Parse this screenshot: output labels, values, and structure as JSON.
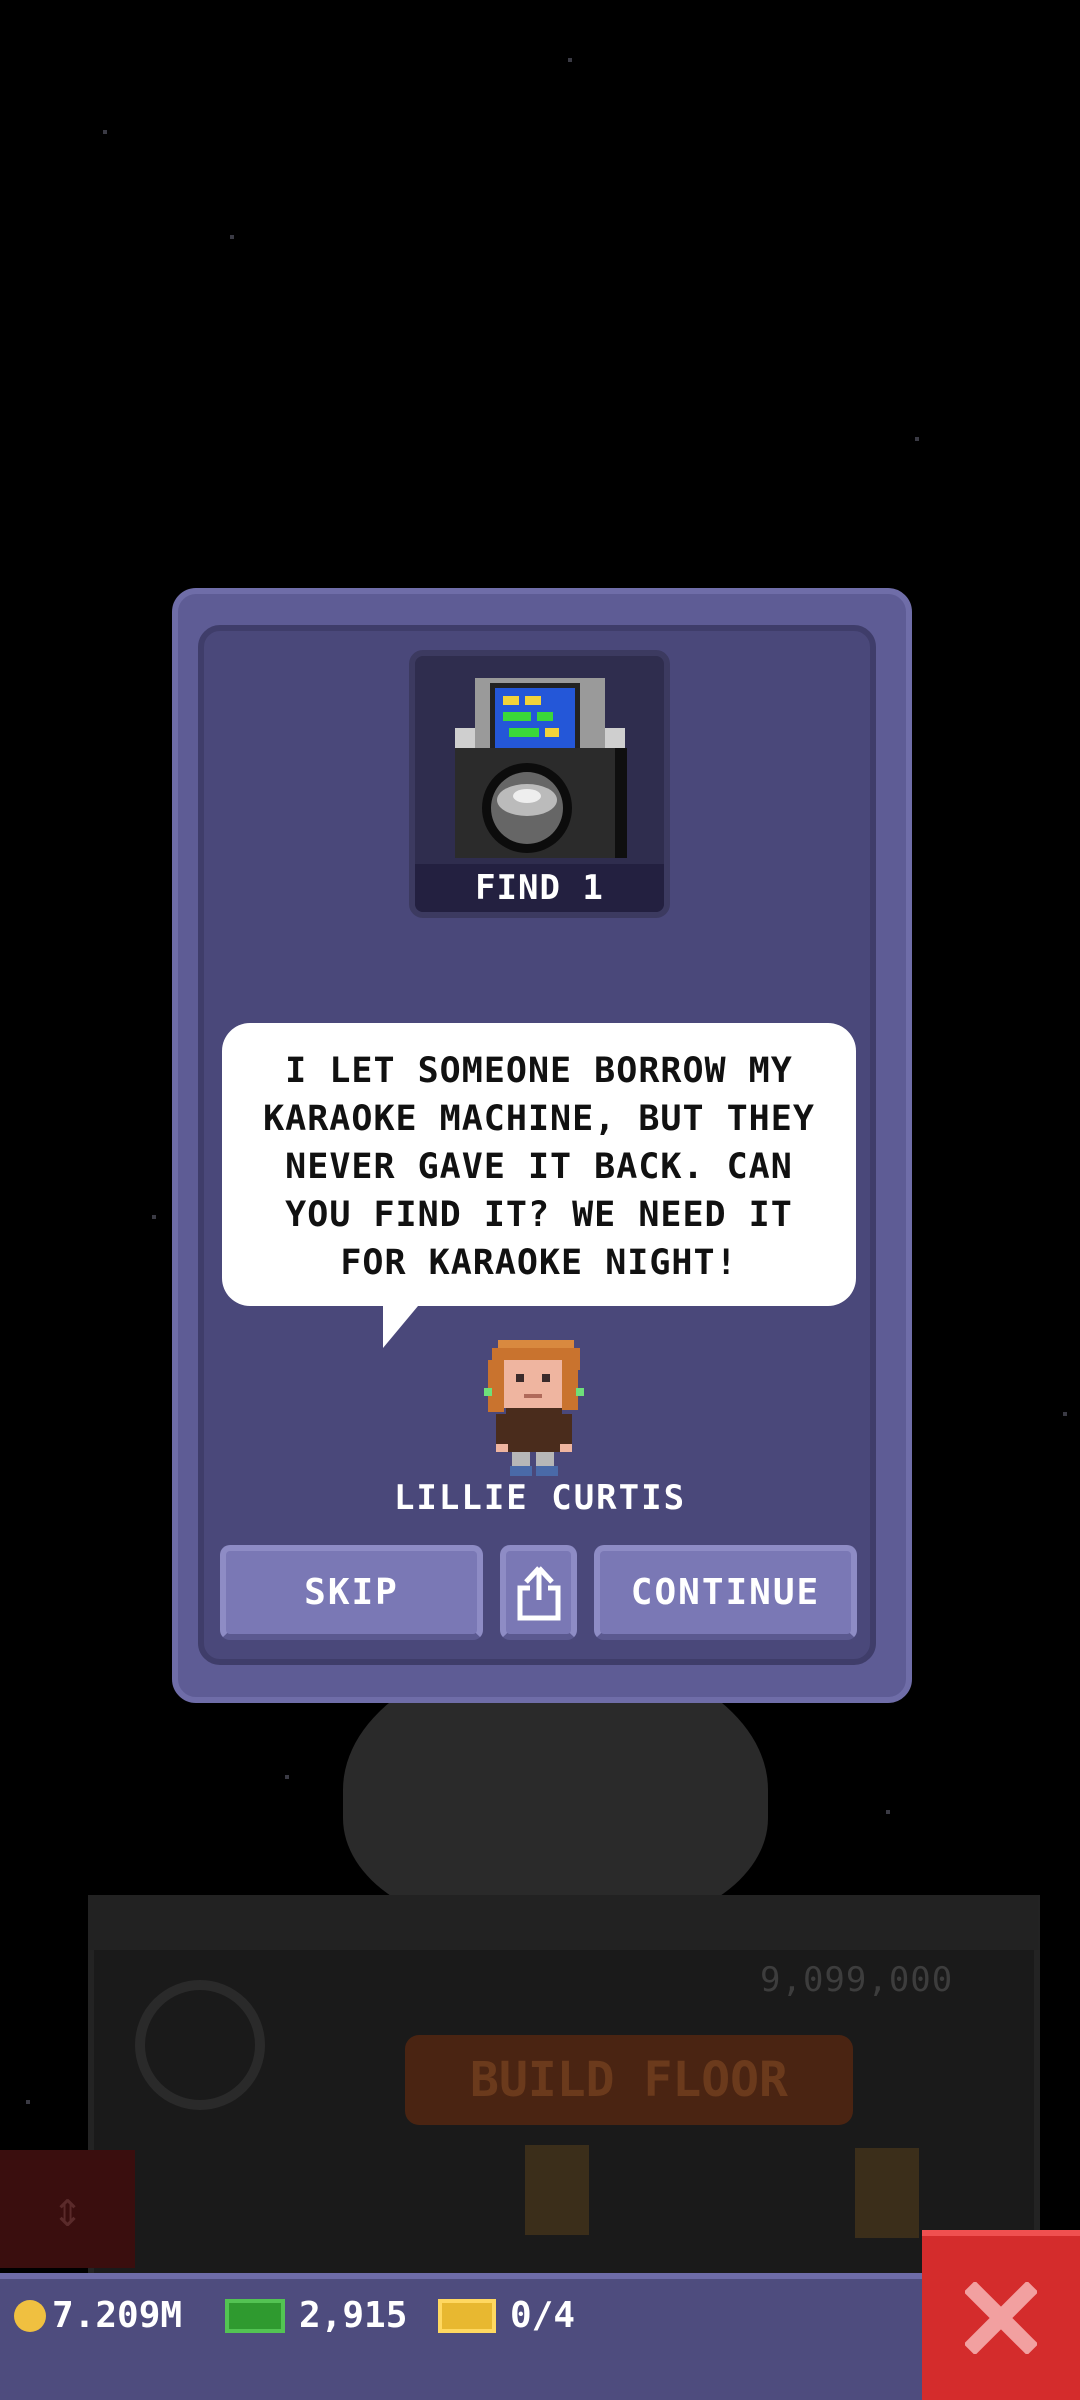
{
  "colors": {
    "modal_bg": "#4a487a",
    "button_bg": "#7a78b5",
    "close_button": "#d42c2c",
    "bottom_bar": "#4e4c7e"
  },
  "quest": {
    "item_icon": "karaoke-machine-icon",
    "find_label": "FIND 1",
    "message": "I LET SOMEONE BORROW MY KARAOKE MACHINE, BUT THEY NEVER GAVE IT BACK. CAN YOU FIND IT? WE NEED IT FOR KARAOKE NIGHT!",
    "character_name": "LILLIE CURTIS"
  },
  "buttons": {
    "skip": "SKIP",
    "share_icon": "share-icon",
    "continue": "CONTINUE"
  },
  "background": {
    "floor_cost": "9,099,000",
    "build_floor": "BUILD FLOOR"
  },
  "resources": {
    "coins": "7.209M",
    "tower_bux": "2,915",
    "tickets": "0/4"
  },
  "close_icon": "close-x-icon"
}
